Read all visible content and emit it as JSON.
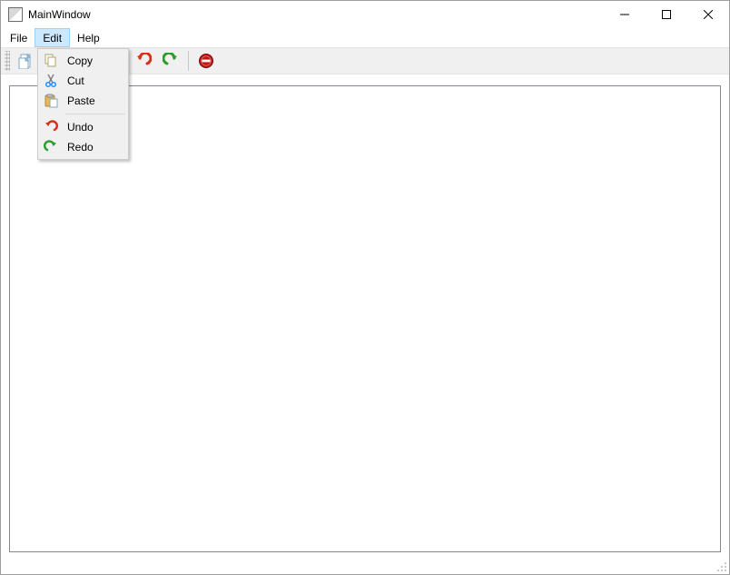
{
  "window": {
    "title": "MainWindow"
  },
  "menubar": {
    "items": [
      {
        "label": "File"
      },
      {
        "label": "Edit"
      },
      {
        "label": "Help"
      }
    ]
  },
  "toolbar": {
    "buttons": [
      {
        "name": "new"
      },
      {
        "name": "copy"
      },
      {
        "name": "cut"
      },
      {
        "name": "paste"
      },
      {
        "name": "undo"
      },
      {
        "name": "redo"
      },
      {
        "name": "stop"
      }
    ]
  },
  "edit_menu": {
    "items": [
      {
        "label": "Copy"
      },
      {
        "label": "Cut"
      },
      {
        "label": "Paste"
      }
    ],
    "items2": [
      {
        "label": "Undo"
      },
      {
        "label": "Redo"
      }
    ]
  }
}
